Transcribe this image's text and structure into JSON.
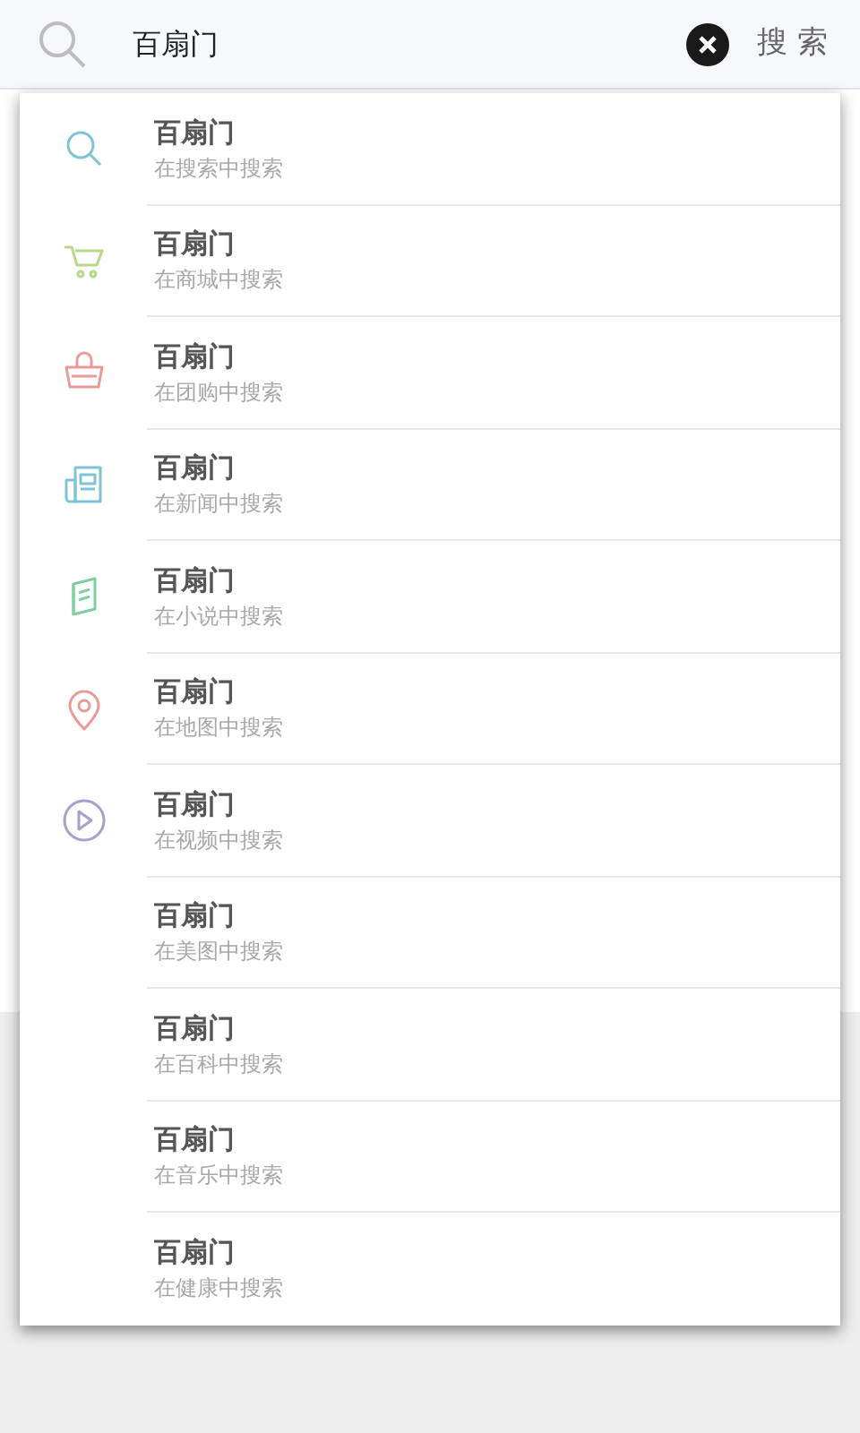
{
  "search_bar": {
    "value": "百扇门",
    "button": "搜 索"
  },
  "suggestions": [
    {
      "kind": "search",
      "title": "百扇门",
      "subtitle": "在搜索中搜索"
    },
    {
      "kind": "mall",
      "title": "百扇门",
      "subtitle": "在商城中搜索"
    },
    {
      "kind": "group",
      "title": "百扇门",
      "subtitle": "在团购中搜索"
    },
    {
      "kind": "news",
      "title": "百扇门",
      "subtitle": "在新闻中搜索"
    },
    {
      "kind": "novel",
      "title": "百扇门",
      "subtitle": "在小说中搜索"
    },
    {
      "kind": "map",
      "title": "百扇门",
      "subtitle": "在地图中搜索"
    },
    {
      "kind": "video",
      "title": "百扇门",
      "subtitle": "在视频中搜索"
    },
    {
      "kind": "plain",
      "title": "百扇门",
      "subtitle": "在美图中搜索"
    },
    {
      "kind": "plain",
      "title": "百扇门",
      "subtitle": "在百科中搜索"
    },
    {
      "kind": "plain",
      "title": "百扇门",
      "subtitle": "在音乐中搜索"
    },
    {
      "kind": "plain",
      "title": "百扇门",
      "subtitle": "在健康中搜索"
    }
  ]
}
